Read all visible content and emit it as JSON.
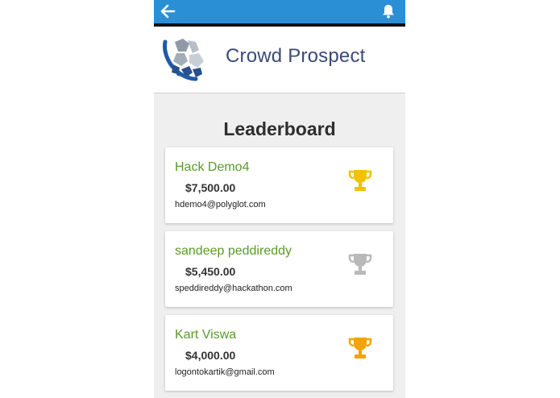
{
  "app": {
    "title": "Crowd Prospect",
    "back_icon": "arrow-left-icon",
    "notification_icon": "bell-icon",
    "appbar_color": "#2b8fd6"
  },
  "page": {
    "title": "Leaderboard"
  },
  "leaders": [
    {
      "name": "Hack Demo4",
      "amount": "$7,500.00",
      "email": "hdemo4@polyglot.com",
      "trophy_icon": "trophy-icon",
      "trophy_color": "#f2c100"
    },
    {
      "name": "sandeep peddireddy",
      "amount": "$5,450.00",
      "email": "speddireddy@hackathon.com",
      "trophy_icon": "trophy-icon",
      "trophy_color": "#b9b9b9"
    },
    {
      "name": "Kart Viswa",
      "amount": "$4,000.00",
      "email": "logontokartik@gmail.com",
      "trophy_icon": "trophy-icon",
      "trophy_color": "#f2a400"
    }
  ]
}
